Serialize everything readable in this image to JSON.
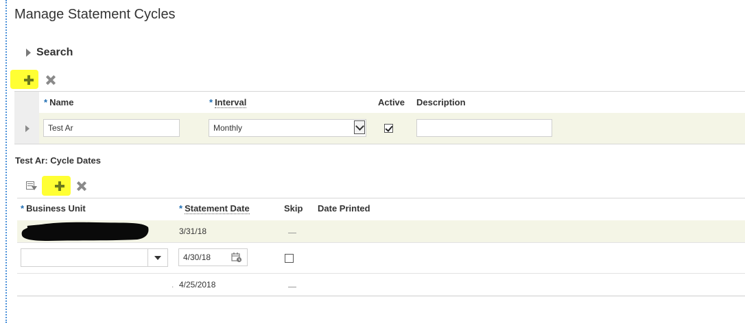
{
  "page": {
    "title": "Manage Statement Cycles"
  },
  "search": {
    "label": "Search"
  },
  "cycles": {
    "columns": {
      "name": "Name",
      "interval": "Interval",
      "active": "Active",
      "description": "Description"
    },
    "required_marker": "*",
    "row": {
      "name": "Test Ar",
      "interval": "Monthly",
      "active": true,
      "description": ""
    }
  },
  "cycle_dates": {
    "title": "Test Ar: Cycle Dates",
    "columns": {
      "business_unit": "Business Unit",
      "statement_date": "Statement Date",
      "skip": "Skip",
      "date_printed": "Date Printed"
    },
    "required_marker": "*",
    "rows": [
      {
        "business_unit": "[redacted]",
        "statement_date": "3/31/18",
        "skip": "—",
        "date_printed": ""
      },
      {
        "business_unit": "",
        "statement_date": "4/30/18",
        "skip": "",
        "date_printed": ""
      },
      {
        "business_unit": ".",
        "statement_date": "4/25/2018",
        "skip": "—",
        "date_printed": ""
      }
    ]
  },
  "colors": {
    "highlight": "#ffff33",
    "add_icon": "#6b7a1e",
    "required": "#1f6eb3",
    "selected_row": "#f4f5e6"
  },
  "icons": [
    "expand-triangle-icon",
    "add-icon",
    "delete-icon",
    "filter-icon",
    "calendar-icon",
    "dropdown-icon",
    "checkbox-icon"
  ]
}
